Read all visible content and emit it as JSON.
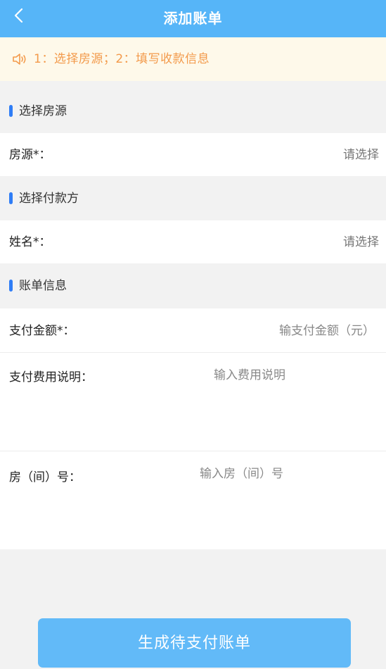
{
  "header": {
    "title": "添加账单",
    "back_icon": "chevron-left-icon"
  },
  "notice": {
    "icon": "speaker-icon",
    "text": "1：选择房源；2：填写收款信息"
  },
  "sections": {
    "property": "选择房源",
    "payer": "选择付款方",
    "bill": "账单信息"
  },
  "property_row": {
    "label": "房源*：",
    "value": "请选择"
  },
  "payer_row": {
    "label": "姓名*：",
    "value": "请选择"
  },
  "amount_row": {
    "label": "支付金额*：",
    "placeholder": "输支付金额（元）"
  },
  "desc_row": {
    "label": "支付费用说明：",
    "placeholder": "输入费用说明"
  },
  "room_row": {
    "label": "房（间）号：",
    "placeholder": "输入房（间）号"
  },
  "submit_button": {
    "label": "生成待支付账单"
  },
  "colors": {
    "header": "#56b5f8",
    "notice_bg": "#fef9ea",
    "notice_text": "#f39a4b",
    "section_bar": "#2f7df6",
    "button": "#62baf8"
  }
}
